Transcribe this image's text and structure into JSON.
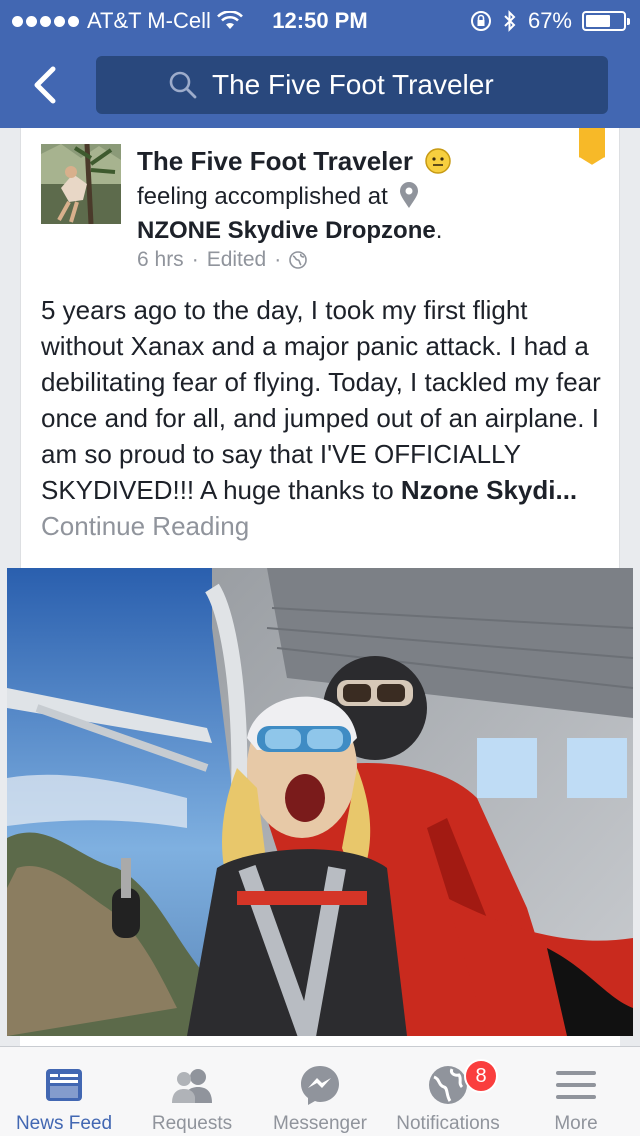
{
  "status_bar": {
    "carrier": "AT&T M-Cell",
    "time": "12:50 PM",
    "battery_percent": "67%",
    "battery_level": 0.67
  },
  "header": {
    "search_text": "The Five Foot Traveler"
  },
  "post": {
    "author": "The Five Foot Traveler",
    "feeling": "feeling accomplished at",
    "place": "NZONE Skydive Dropzone",
    "place_suffix": ".",
    "time": "6 hrs",
    "edited": "Edited",
    "separator": "·",
    "body": "5 years ago to the day, I took my first flight without Xanax and a major panic attack. I had a debilitating fear of flying. Today, I tackled my fear once and for all, and jumped out of an airplane. I am so proud to say that I'VE OFFICIALLY SKYDIVED!!! A huge thanks to ",
    "body_bold": "Nzone Skydi",
    "ellipsis": "... ",
    "continue_label": "Continue Reading"
  },
  "tabs": [
    {
      "label": "News Feed",
      "icon": "news-feed-icon",
      "active": true
    },
    {
      "label": "Requests",
      "icon": "friend-requests-icon"
    },
    {
      "label": "Messenger",
      "icon": "messenger-icon"
    },
    {
      "label": "Notifications",
      "icon": "globe-icon",
      "badge": "8"
    },
    {
      "label": "More",
      "icon": "menu-icon"
    }
  ],
  "colors": {
    "brand": "#4267b2",
    "badge": "#fa3e3e",
    "bookmark": "#f7b928"
  }
}
